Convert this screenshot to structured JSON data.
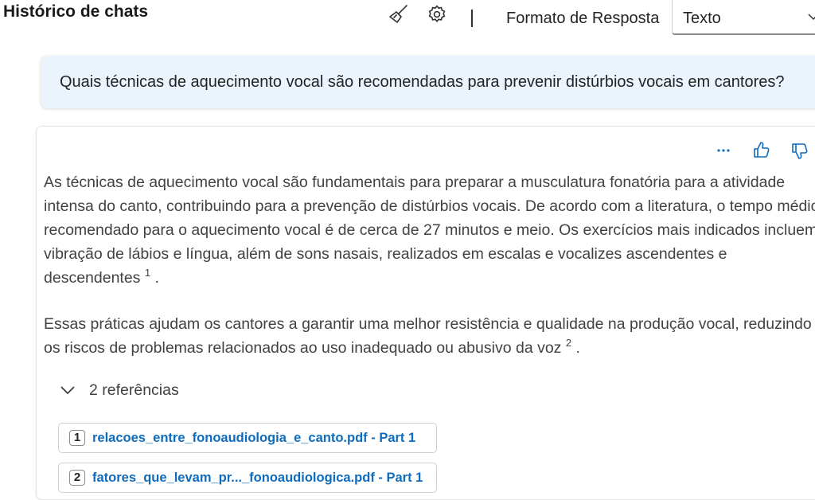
{
  "header": {
    "title": "Histórico de chats",
    "clear_icon": "broom-icon",
    "settings_icon": "gear-icon",
    "format_label": "Formato de Resposta",
    "format_value": "Texto"
  },
  "question": "Quais técnicas de aquecimento vocal são recomendadas para prevenir distúrbios vocais em cantores?",
  "answer": {
    "actions": [
      "more-icon",
      "thumbs-up-icon",
      "thumbs-down-icon"
    ],
    "paragraph1": "As técnicas de aquecimento vocal são fundamentais para preparar a musculatura fonatória para a atividade intensa do canto, contribuindo para a prevenção de distúrbios vocais. De acordo com a literatura, o tempo médio recomendado para o aquecimento vocal é de cerca de 27 minutos e meio. Os exercícios mais indicados incluem vibração de lábios e língua, além de sons nasais, realizados em escalas e vocalizes ascendentes e descendentes",
    "citation1": "1",
    "paragraph2": "Essas práticas ajudam os cantores a garantir uma melhor resistência e qualidade na produção vocal, reduzindo os riscos de problemas relacionados ao uso inadequado ou abusivo da voz",
    "citation2": "2",
    "period": ".",
    "references_label": "2 referências",
    "references": [
      {
        "num": "1",
        "name": "relacoes_entre_fonoaudiologia_e_canto.pdf - Part 1"
      },
      {
        "num": "2",
        "name": "fatores_que_levam_pr..._fonoaudiologica.pdf - Part 1"
      }
    ]
  }
}
